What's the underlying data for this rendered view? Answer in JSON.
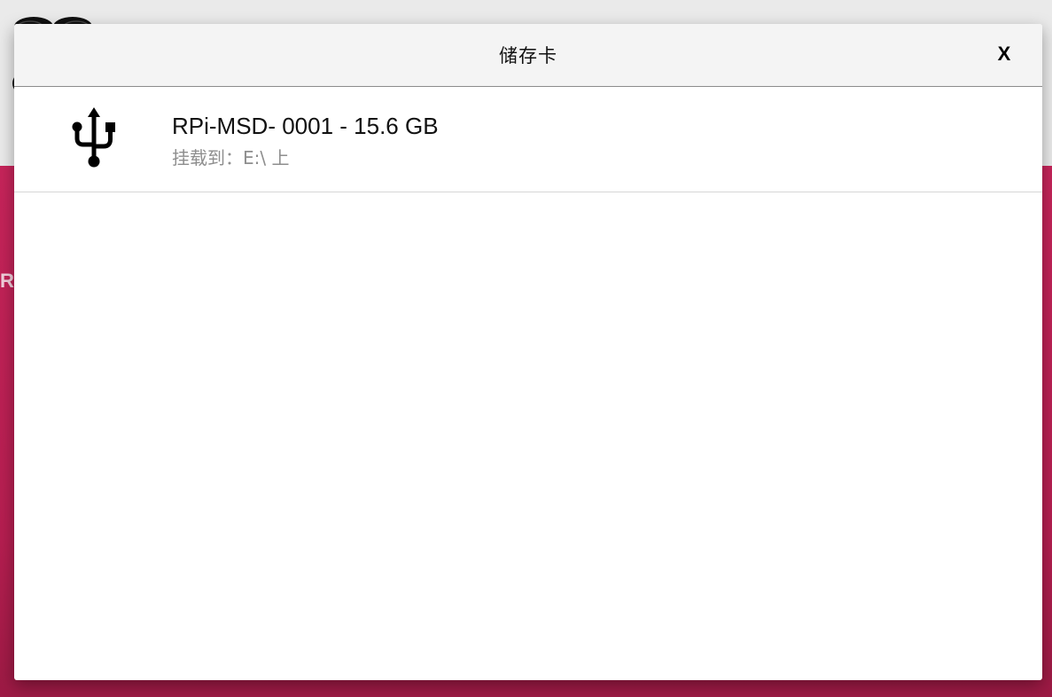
{
  "background": {
    "side_letter": "R",
    "brand_color": "#c6245a"
  },
  "dialog": {
    "title": "储存卡",
    "close_label": "X"
  },
  "devices": [
    {
      "name": "RPi-MSD- 0001 - 15.6 GB",
      "mount_text": "挂载到：E:\\ 上",
      "icon": "usb-icon"
    }
  ]
}
